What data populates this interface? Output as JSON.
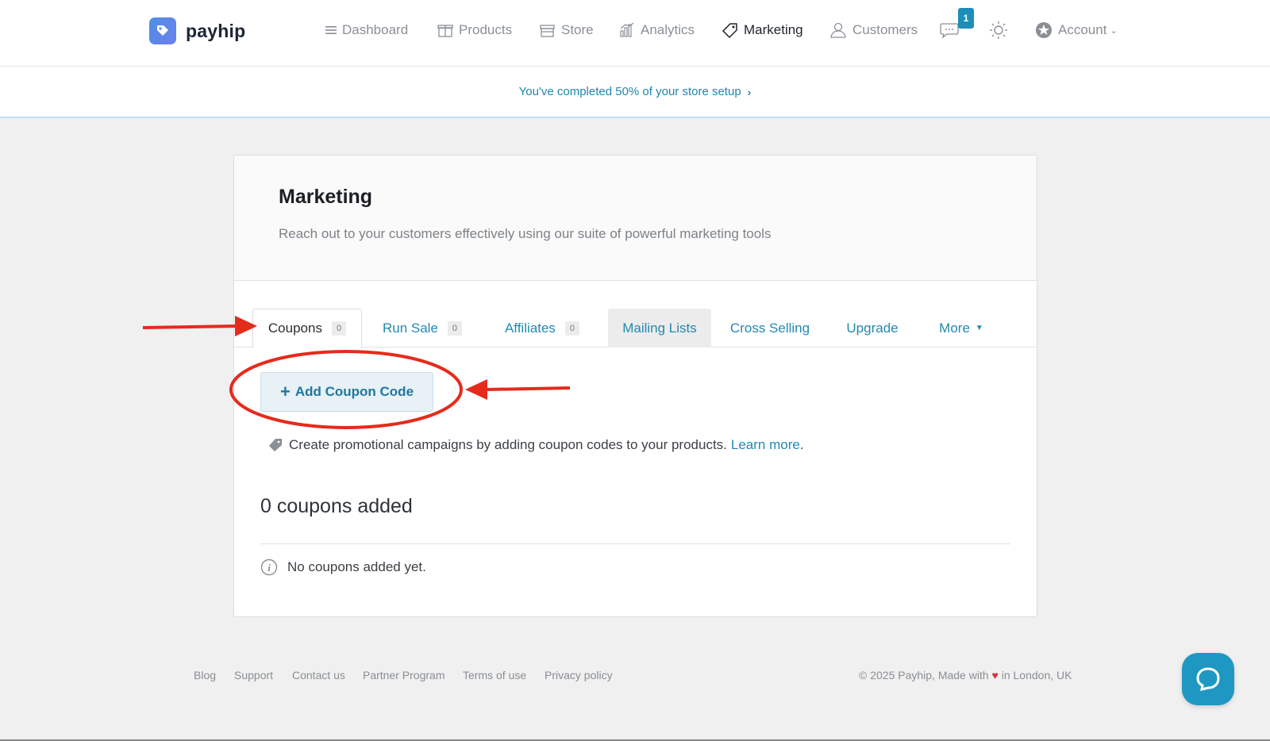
{
  "brand": {
    "name": "payhip"
  },
  "nav": {
    "items": [
      {
        "label": "Dashboard",
        "icon": "menu-icon"
      },
      {
        "label": "Products",
        "icon": "gift-icon"
      },
      {
        "label": "Store",
        "icon": "store-icon"
      },
      {
        "label": "Analytics",
        "icon": "chart-icon"
      },
      {
        "label": "Marketing",
        "icon": "tag-icon",
        "active": true
      },
      {
        "label": "Customers",
        "icon": "user-icon"
      }
    ],
    "notifications_count": "1",
    "account_label": "Account"
  },
  "setup_banner": {
    "text": "You've completed 50% of your store setup",
    "progress_percent": 50
  },
  "page": {
    "title": "Marketing",
    "subtitle": "Reach out to your customers effectively using our suite of powerful marketing tools"
  },
  "tabs": [
    {
      "label": "Coupons",
      "count": "0"
    },
    {
      "label": "Run Sale",
      "count": "0"
    },
    {
      "label": "Affiliates",
      "count": "0"
    },
    {
      "label": "Mailing Lists"
    },
    {
      "label": "Cross Selling"
    },
    {
      "label": "Upgrade"
    },
    {
      "label": "More"
    }
  ],
  "coupons": {
    "add_button": "Add Coupon Code",
    "promo_text": "Create promotional campaigns by adding coupon codes to your products.",
    "learn_more": "Learn more",
    "count_title": "0 coupons added",
    "empty_text": "No coupons added yet."
  },
  "footer": {
    "links": [
      "Blog",
      "Support",
      "Contact us",
      "Partner Program",
      "Terms of use",
      "Privacy policy"
    ],
    "copyright_prefix": "© 2025 Payhip, Made with",
    "copyright_suffix": "in London, UK"
  },
  "colors": {
    "accent": "#2289b0",
    "annotation": "#e52b1c"
  }
}
